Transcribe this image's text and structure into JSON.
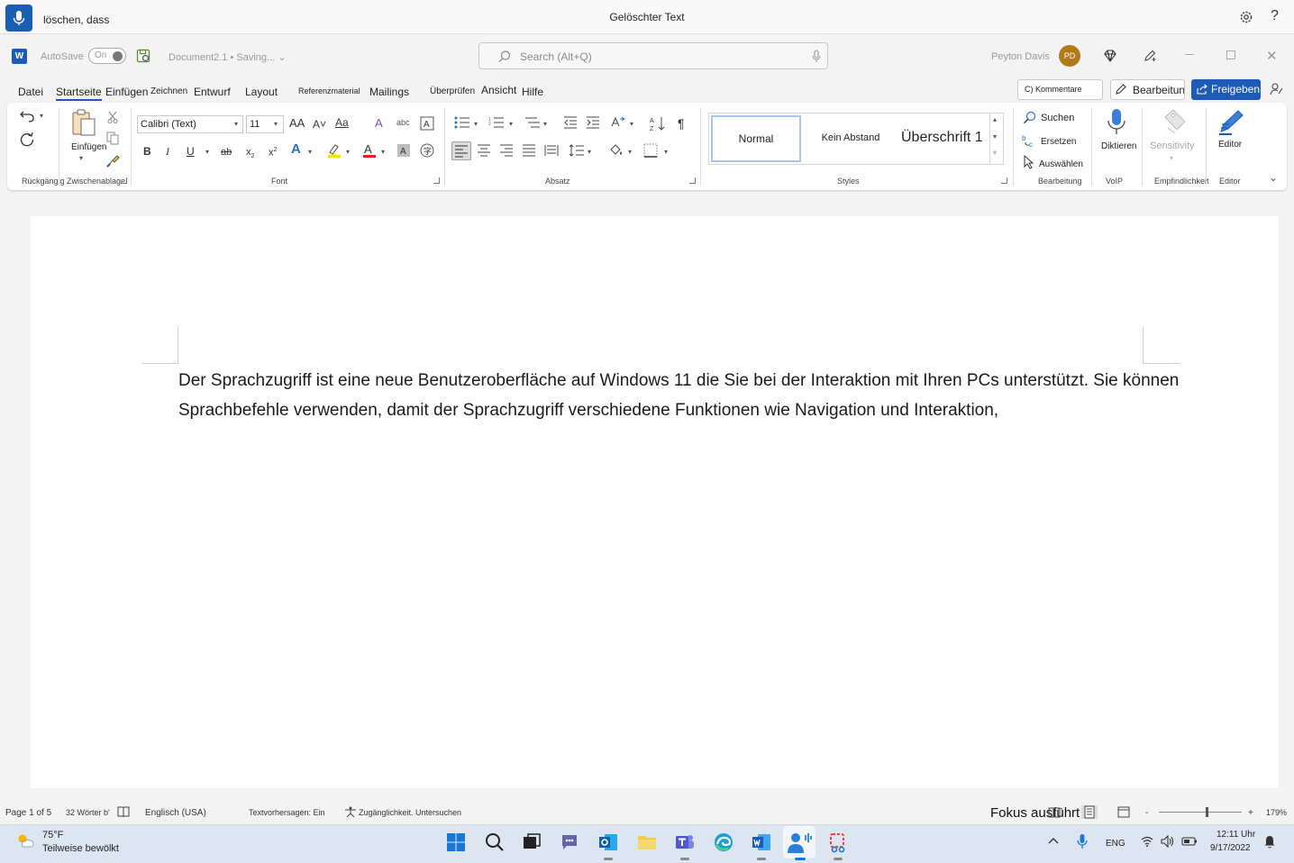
{
  "voice_access": {
    "last_command": "löschen, dass",
    "status_title": "Gelöschter Text"
  },
  "word": {
    "autosave_label": "AutoSave",
    "autosave_state": "On",
    "document_name": "Document2.1 • Saving...",
    "search_placeholder": "Search (Alt+Q)",
    "user_name": "Peyton Davis",
    "user_initials": "PD",
    "app_icon_letter": "W"
  },
  "tabs": [
    "Datei",
    "Startseite",
    "Einfügen",
    "Zeichnen",
    "Entwurf",
    "Layout",
    "Referenzmaterial",
    "Mailings",
    "Überprüfen",
    "Ansicht",
    "Hilfe"
  ],
  "tab_actions": {
    "comments": "C) Kommentare",
    "editing": "Bearbeitung",
    "share": "Freigeben"
  },
  "ribbon": {
    "groups": {
      "undo": "Rückgängig",
      "clipboard": "Zwischenablage",
      "font": "Font",
      "paragraph": "Absatz",
      "styles": "Styles",
      "editing": "Bearbeitung",
      "voip": "VoIP",
      "sensitivity_group": "Empfindlichkeit",
      "editor_group": "Editor"
    },
    "paste": "Einfügen",
    "font_name": "Calibri (Text)",
    "font_size": "11",
    "styles": [
      "Normal",
      "Kein Abstand",
      "Überschrift 1"
    ],
    "find": "Suchen",
    "replace": "Ersetzen",
    "select": "Auswählen",
    "dictate": "Diktieren",
    "sensitivity": "Sensitivity",
    "editor": "Editor"
  },
  "document": {
    "body": "Der Sprachzugriff ist eine neue Benutzeroberfläche auf Windows 11 die Sie bei der Interaktion mit Ihren PCs unterstützt. Sie können Sprachbefehle verwenden, damit der Sprachzugriff verschiedene Funktionen wie Navigation und Interaktion,"
  },
  "status": {
    "page": "Page 1 of 5",
    "words": "32 Wörter b'",
    "language": "Englisch (USA)",
    "predictions": "Textvorhersagen: Ein",
    "accessibility": "Zugänglichkeit. Untersuchen",
    "focus": "Fokus ausführt",
    "zoom": "179%",
    "zoom_minus": "-",
    "zoom_plus": "+"
  },
  "taskbar": {
    "weather_temp": "75°F",
    "weather_desc": "Teilweise bewölkt",
    "language": "ENG",
    "time": "12:11 Uhr",
    "date": "9/17/2022"
  },
  "colors": {
    "accent": "#1e5bb8",
    "voice_mic": "#1a5fb4",
    "avatar": "#b07a18"
  }
}
